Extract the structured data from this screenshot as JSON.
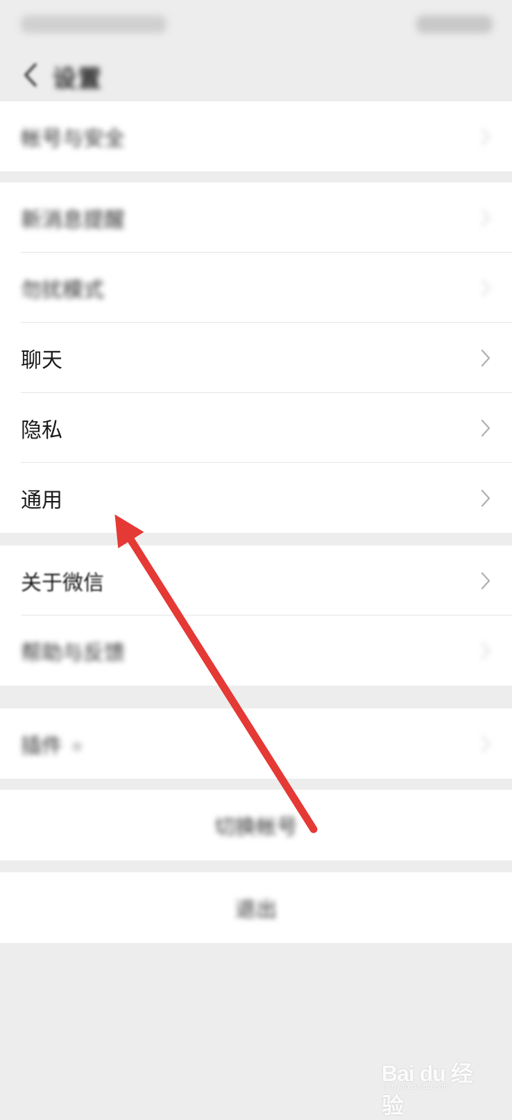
{
  "status_bar": {
    "left_text": "",
    "right_text": ""
  },
  "nav": {
    "title": "设置"
  },
  "groups": [
    {
      "items": [
        {
          "label": "帐号与安全",
          "blurred": true
        }
      ]
    },
    {
      "items": [
        {
          "label": "新消息提醒",
          "blurred": true
        },
        {
          "label": "勿扰模式",
          "blurred": true
        },
        {
          "label": "聊天",
          "blurred": false
        },
        {
          "label": "隐私",
          "blurred": false
        },
        {
          "label": "通用",
          "blurred": false
        }
      ]
    },
    {
      "items": [
        {
          "label": "关于微信",
          "blurred": false
        },
        {
          "label": "帮助与反馈",
          "blurred": true
        }
      ]
    },
    {
      "items": [
        {
          "label": "插件",
          "blurred": true
        }
      ]
    }
  ],
  "actions": {
    "switch_account": "切换帐号",
    "logout": "退出"
  },
  "annotation": {
    "arrow_color": "#e53935"
  },
  "watermark": {
    "logo": "Bai du 经验",
    "sub": "jingyan.baidu.com"
  }
}
